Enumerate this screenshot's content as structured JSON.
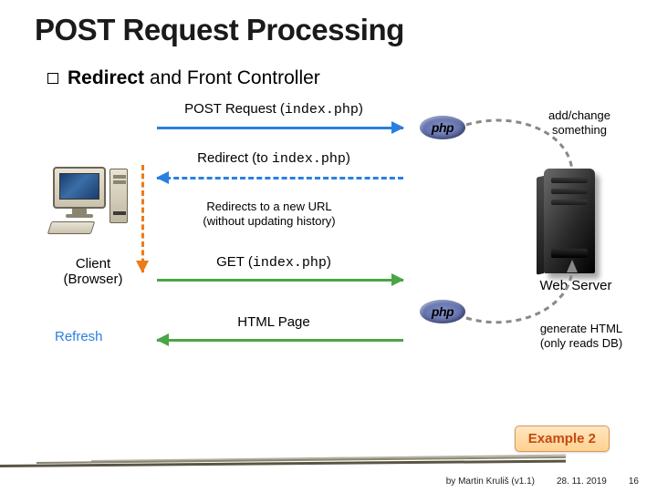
{
  "title": "POST Request Processing",
  "bullet": {
    "strong": "Redirect",
    "rest": " and Front Controller"
  },
  "diagram": {
    "post_request": {
      "label": "POST Request (",
      "code": "index.php",
      "tail": ")"
    },
    "redirect_to": {
      "label": "Redirect (to ",
      "code": "index.php",
      "tail": ")"
    },
    "redirect_note": "Redirects to a new URL\n(without updating history)",
    "get_request": {
      "label": "GET (",
      "code": "index.php",
      "tail": ")"
    },
    "html_page": "HTML Page",
    "client_label": "Client\n(Browser)",
    "refresh_label": "Refresh",
    "server_label": "Web Server",
    "php_label": "php",
    "add_change": "add/change\nsomething",
    "generate_html": "generate HTML\n(only reads DB)"
  },
  "example_button": "Example 2",
  "footer": {
    "author": "by Martin Kruliš (v1.1)",
    "date": "28. 11. 2019",
    "page": "16"
  }
}
